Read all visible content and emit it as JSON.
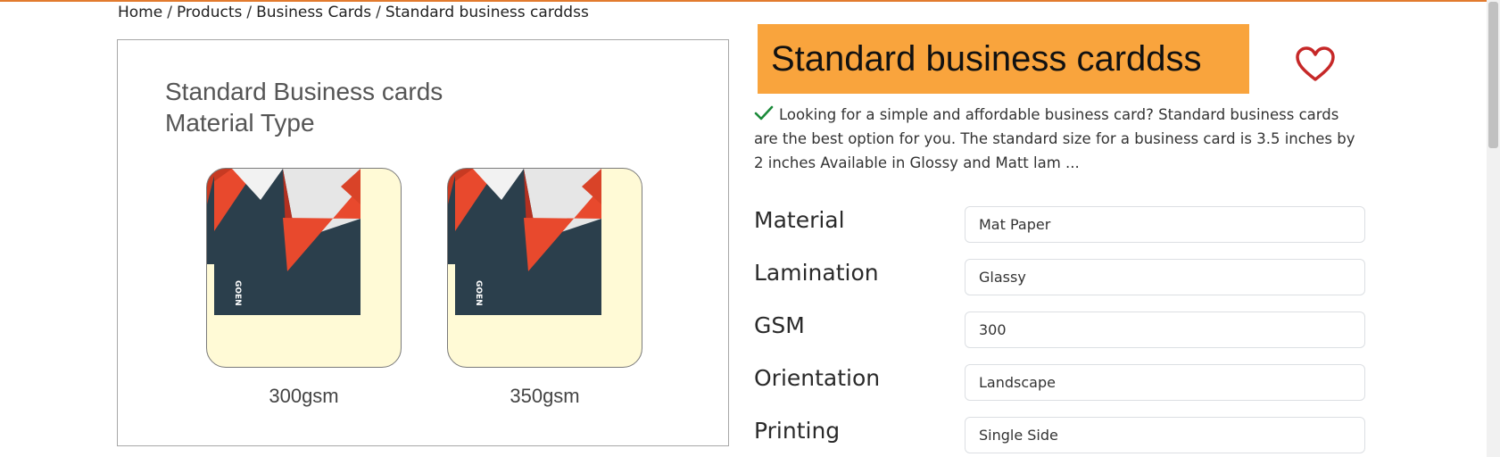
{
  "breadcrumb": [
    "Home",
    "Products",
    "Business Cards",
    "Standard business carddss"
  ],
  "image_panel": {
    "title_line1": "Standard Business cards",
    "title_line2": "Material Type",
    "options": [
      {
        "label": "300gsm",
        "card_text": "GOEN"
      },
      {
        "label": "350gsm",
        "card_text": "GOEN"
      }
    ]
  },
  "product": {
    "title": "Standard business carddss",
    "description": "Looking for a simple and affordable business card? Standard business cards are the best option for you. The standard size for a business card is 3.5 inches by 2 inches Available in Glossy and Matt lam ..."
  },
  "specs": [
    {
      "label": "Material",
      "value": "Mat Paper"
    },
    {
      "label": "Lamination",
      "value": "Glassy"
    },
    {
      "label": "GSM",
      "value": "300"
    },
    {
      "label": "Orientation",
      "value": "Landscape"
    },
    {
      "label": "Printing",
      "value": "Single Side"
    }
  ],
  "icons": {
    "favorite": "heart-icon",
    "check": "check-icon"
  },
  "colors": {
    "accent": "#f9a43d",
    "top_line": "#e27b2f",
    "heart": "#c62828",
    "check": "#1b8a3a"
  }
}
